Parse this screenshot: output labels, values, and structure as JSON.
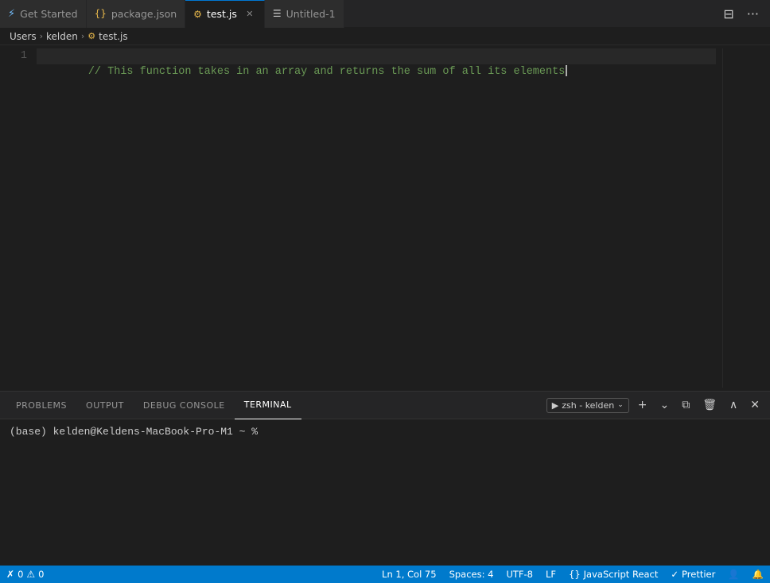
{
  "tabs": [
    {
      "id": "get-started",
      "icon": "⚡",
      "label": "Get Started",
      "active": false,
      "closable": false,
      "iconColor": "#75bfff"
    },
    {
      "id": "package-json",
      "icon": "{}",
      "label": "package.json",
      "active": false,
      "closable": false,
      "iconColor": "#e8b84b"
    },
    {
      "id": "test-js",
      "icon": "⚙",
      "label": "test.js",
      "active": true,
      "closable": true,
      "iconColor": "#e8b84b"
    },
    {
      "id": "untitled-1",
      "icon": "☰",
      "label": "Untitled-1",
      "active": false,
      "closable": false,
      "iconColor": "#cccccc"
    }
  ],
  "breadcrumb": {
    "parts": [
      "Users",
      "kelden"
    ],
    "icon": "⚙",
    "file": "test.js"
  },
  "editor": {
    "lines": [
      {
        "num": 1,
        "code": "// This function takes in an array and returns the sum of all its elements",
        "type": "comment",
        "active": true
      }
    ]
  },
  "panel": {
    "tabs": [
      {
        "id": "problems",
        "label": "PROBLEMS",
        "active": false
      },
      {
        "id": "output",
        "label": "OUTPUT",
        "active": false
      },
      {
        "id": "debug-console",
        "label": "DEBUG CONSOLE",
        "active": false
      },
      {
        "id": "terminal",
        "label": "TERMINAL",
        "active": true
      }
    ],
    "terminal_instance": "zsh - kelden",
    "terminal_prompt": "(base) kelden@Keldens-MacBook-Pro-M1 ~ % "
  },
  "status_bar": {
    "errors": "0",
    "position": "Ln 1, Col 75",
    "spaces": "Spaces: 4",
    "encoding": "UTF-8",
    "line_ending": "LF",
    "language": "JavaScript React",
    "formatter": "Prettier",
    "notifications_icon": "🔔",
    "accounts_icon": "👤"
  },
  "icons": {
    "layout": "⊟",
    "more": "···",
    "terminal_run": "▶",
    "add": "+",
    "dropdown": "⌄",
    "split": "⧉",
    "trash": "🗑",
    "chevron_up": "∧",
    "close": "✕",
    "check": "✓",
    "warning": "⚠",
    "error": "✗",
    "bell": "🔔",
    "person": "👤"
  }
}
